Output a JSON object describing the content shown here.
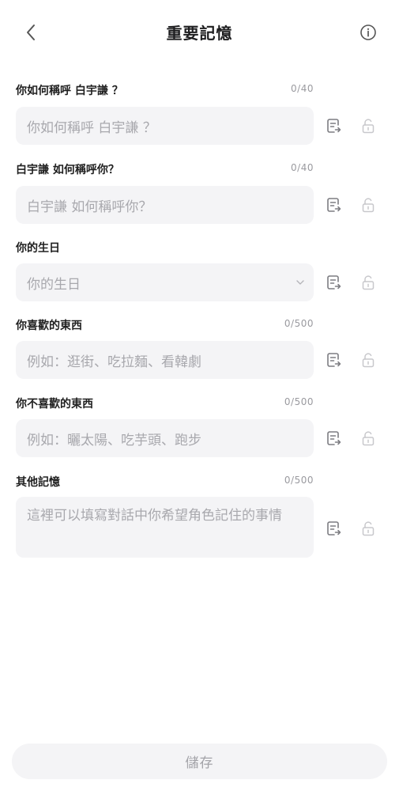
{
  "header": {
    "title": "重要記憶"
  },
  "fields": [
    {
      "label": "你如何稱呼 白宇謙 ？",
      "counter": "0/40",
      "placeholder": "你如何稱呼 白宇謙 ？"
    },
    {
      "label": "白宇謙 如何稱呼你？",
      "counter": "0/40",
      "placeholder": "白宇謙 如何稱呼你？"
    },
    {
      "label": "你的生日",
      "counter": "",
      "placeholder": "你的生日"
    },
    {
      "label": "你喜歡的東西",
      "counter": "0/500",
      "placeholder": "例如：逛街、吃拉麵、看韓劇"
    },
    {
      "label": "你不喜歡的東西",
      "counter": "0/500",
      "placeholder": "例如：曬太陽、吃芋頭、跑步"
    },
    {
      "label": "其他記憶",
      "counter": "0/500",
      "placeholder": "這裡可以填寫對話中你希望角色記住的事情"
    }
  ],
  "save_label": "儲存",
  "colors": {
    "field_background": "#f4f4f6",
    "placeholder": "#a8a8ad",
    "icon_gray": "#7d7d82",
    "lock_gray": "#c8c8cc"
  }
}
